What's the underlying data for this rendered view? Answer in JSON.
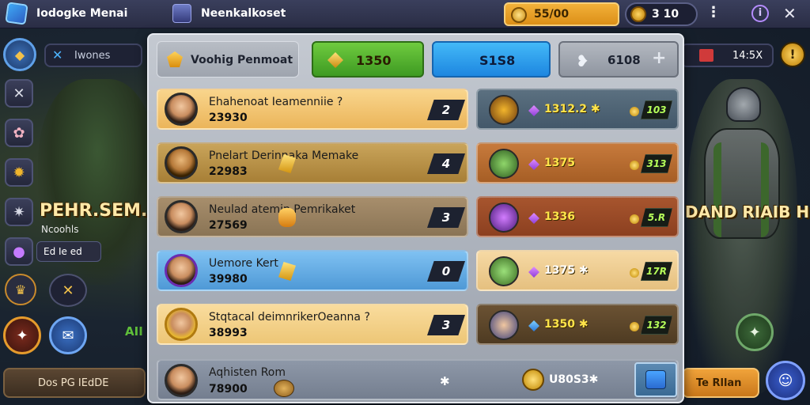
{
  "topbar": {
    "app_title": "Iodogke Menai",
    "tab_title": "Neenkalkoset",
    "gold_value": "55/00",
    "coin_value": "3 10",
    "kebab": "⋮",
    "info": "i",
    "close": "✕"
  },
  "left": {
    "pill_label": "Iwones",
    "big_title": "PEHR.SEM.BI",
    "sub": "Ncoohls",
    "chip": "Ed Ie ed",
    "deco": "AII",
    "bottom_pill": "Dos PG IEdDE"
  },
  "right": {
    "pill_label": "14:5X",
    "coin_icon": "!",
    "big_title": "DAND RIAIB H",
    "bottom_pill": "Te Rllan"
  },
  "panel": {
    "title": "Voohig Penmoat",
    "green_value": "1350",
    "blue_value": "S1S8",
    "gray_value": "6108",
    "rows": [
      {
        "name": "Ehahenoat Ieamenniie ?",
        "score": "23930",
        "rank": "2"
      },
      {
        "name": "Pnelart Derinnaka Memake",
        "score": "22983",
        "rank": "4"
      },
      {
        "name": "Neulad atemin Pemrikaket",
        "score": "27569",
        "rank": "3"
      },
      {
        "name": "Uemore Kert",
        "score": "39980",
        "rank": "0"
      },
      {
        "name": "Stqtacal deimnrikerOeanna ?",
        "score": "38993",
        "rank": "3"
      }
    ],
    "prizes": [
      {
        "value": "1312.2 ✱",
        "tag": "103"
      },
      {
        "value": "1375",
        "tag": "313"
      },
      {
        "value": "1336",
        "tag": "5.R"
      },
      {
        "value": "1375 ✱",
        "tag": "17R"
      },
      {
        "value": "1350 ✱",
        "tag": "132"
      }
    ],
    "bottom": {
      "name": "Aqhisten Rom",
      "score": "78900",
      "star": "✱",
      "gold_value": "U80S3✱"
    }
  }
}
